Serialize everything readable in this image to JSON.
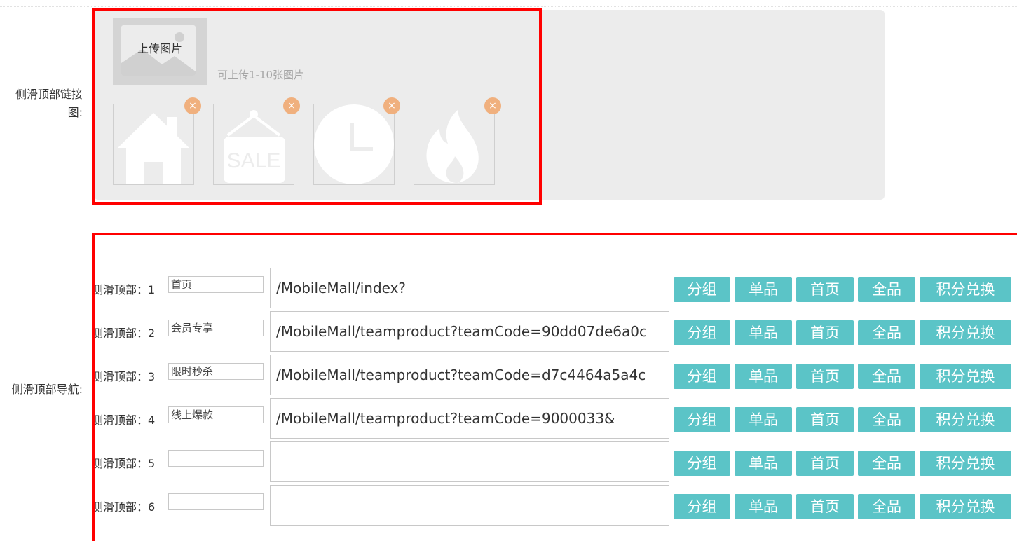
{
  "upload_section": {
    "label": "侧滑顶部链接图:",
    "upload_button_label": "上传图片",
    "hint": "可上传1-10张图片",
    "thumbnails": [
      {
        "icon": "house-icon",
        "delete": "×"
      },
      {
        "icon": "sale-sign-icon",
        "sale_text": "SALE",
        "delete": "×"
      },
      {
        "icon": "clock-icon",
        "delete": "×"
      },
      {
        "icon": "flame-icon",
        "delete": "×"
      }
    ]
  },
  "nav_section": {
    "label": "侧滑顶部导航:",
    "rows": [
      {
        "label": "侧滑顶部：1",
        "name": "首页",
        "url": "/MobileMall/index?"
      },
      {
        "label": "侧滑顶部：2",
        "name": "会员专享",
        "url": "/MobileMall/teamproduct?teamCode=90dd07de6a0c"
      },
      {
        "label": "侧滑顶部：3",
        "name": "限时秒杀",
        "url": "/MobileMall/teamproduct?teamCode=d7c4464a5a4c"
      },
      {
        "label": "侧滑顶部：4",
        "name": "线上爆款",
        "url": "/MobileMall/teamproduct?teamCode=9000033&"
      },
      {
        "label": "侧滑顶部：5",
        "name": "",
        "url": ""
      },
      {
        "label": "侧滑顶部：6",
        "name": "",
        "url": ""
      }
    ],
    "buttons": [
      "分组",
      "单品",
      "首页",
      "全品",
      "积分兑换"
    ]
  },
  "colors": {
    "accent_button": "#5bc4c7",
    "delete_badge": "#f0b07e",
    "highlight_border": "#ff0000",
    "panel_bg": "#ececec"
  }
}
